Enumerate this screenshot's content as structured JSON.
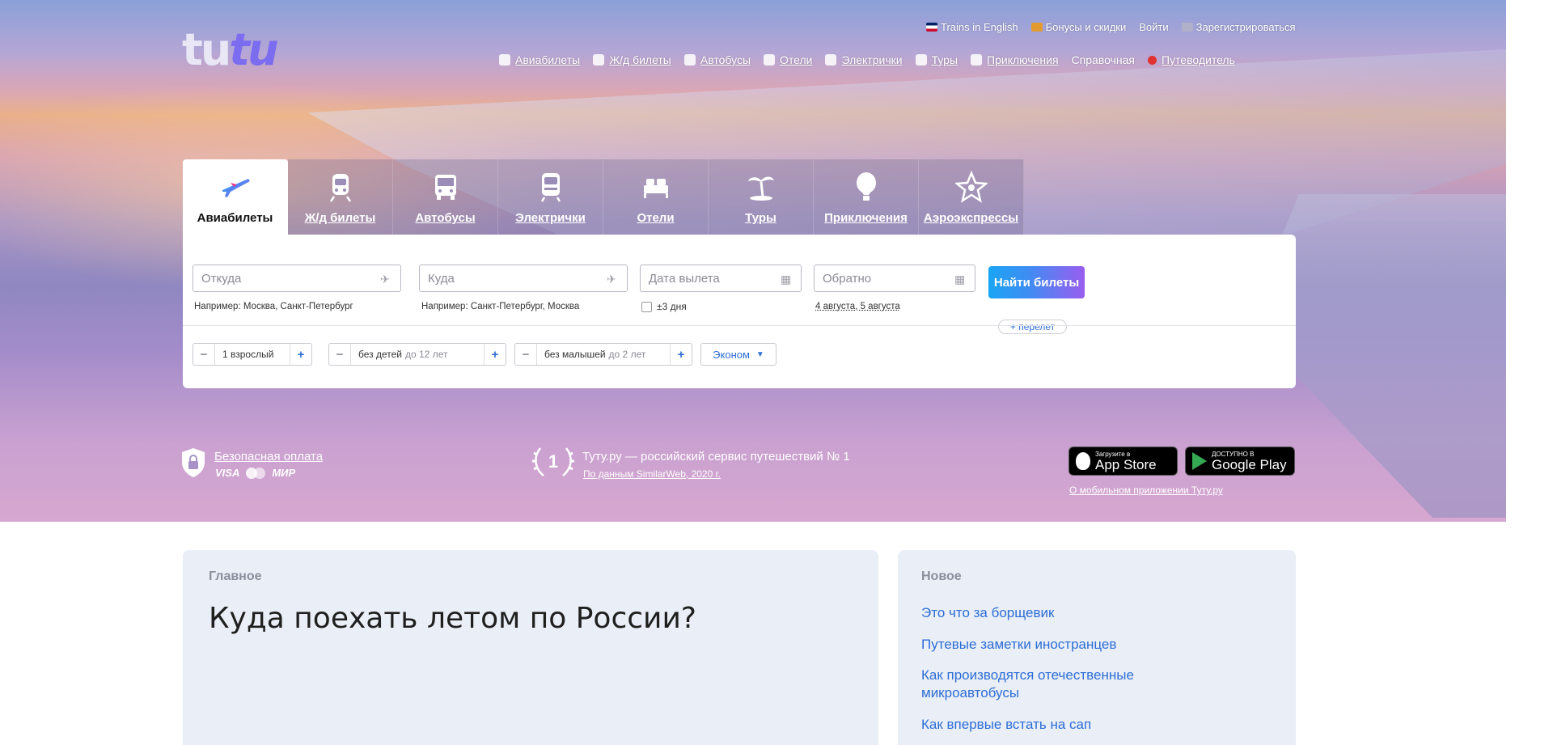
{
  "header": {
    "logo": {
      "part1": "tu",
      "part2": "tu"
    },
    "top_links": [
      {
        "label": "Trains in English",
        "icon": "uk-flag-icon"
      },
      {
        "label": "Бонусы и скидки",
        "icon": "gift-icon"
      },
      {
        "label": "Войти",
        "icon": ""
      },
      {
        "label": "Зарегистрироваться",
        "icon": "cabinet-icon"
      }
    ],
    "nav": [
      {
        "label": "Авиабилеты",
        "icon": "plane-icon"
      },
      {
        "label": "Ж/д билеты",
        "icon": "train-icon"
      },
      {
        "label": "Автобусы",
        "icon": "bus-icon"
      },
      {
        "label": "Отели",
        "icon": "hotel-icon"
      },
      {
        "label": "Электрички",
        "icon": "suburban-train-icon"
      },
      {
        "label": "Туры",
        "icon": "tour-icon"
      },
      {
        "label": "Приключения",
        "icon": "balloon-icon"
      },
      {
        "label": "Справочная",
        "icon": ""
      },
      {
        "label": "Путеводитель",
        "icon": "guide-icon"
      }
    ]
  },
  "search": {
    "tabs": [
      {
        "label": "Авиабилеты",
        "icon": "plane-icon",
        "active": true
      },
      {
        "label": "Ж/д билеты",
        "icon": "train-icon",
        "active": false
      },
      {
        "label": "Автобусы",
        "icon": "bus-icon",
        "active": false
      },
      {
        "label": "Электрички",
        "icon": "suburban-train-icon",
        "active": false
      },
      {
        "label": "Отели",
        "icon": "bed-icon",
        "active": false
      },
      {
        "label": "Туры",
        "icon": "palm-icon",
        "active": false
      },
      {
        "label": "Приключения",
        "icon": "balloon-icon",
        "active": false
      },
      {
        "label": "Аэроэкспрессы",
        "icon": "star-icon",
        "active": false
      }
    ],
    "from": {
      "placeholder": "Откуда",
      "hint": "Например: Москва, Санкт-Петербург"
    },
    "to": {
      "placeholder": "Куда",
      "hint": "Например: Санкт-Петербург, Москва"
    },
    "depart": {
      "placeholder": "Дата вылета",
      "flex_label": "±3 дня"
    },
    "return": {
      "placeholder": "Обратно",
      "hint": "4 августа, 5 августа"
    },
    "find_button": "Найти билеты",
    "add_flight": "+ перелет",
    "adults": {
      "value": "1 взрослый"
    },
    "children": {
      "value": "без детей",
      "suffix": "до 12 лет"
    },
    "infants": {
      "value": "без малышей",
      "suffix": "до 2 лет"
    },
    "class": {
      "value": "Эконом"
    }
  },
  "trust": {
    "safe_payment": "Безопасная оплата",
    "pay_systems": [
      "VISA",
      "МИР"
    ],
    "award_number": "1",
    "award_title": "Туту.ру — российский сервис путешествий № 1",
    "award_source": "По данным SimilarWeb, 2020 г.",
    "app_store": {
      "small": "Загрузите в",
      "big": "App Store"
    },
    "google_play": {
      "small": "ДОСТУПНО В",
      "big": "Google Play"
    },
    "mobile_link": "О мобильном приложении Туту.ру"
  },
  "content": {
    "main_label": "Главное",
    "main_title": "Куда поехать летом по России?",
    "new_label": "Новое",
    "news": [
      "Это что за борщевик",
      "Путевые заметки иностранцев",
      "Как производятся отечественные микроавтобусы",
      "Как впервые встать на сап"
    ]
  },
  "colors": {
    "accent": "#2d6ed6",
    "logo_purple": "#7b6cf0",
    "button_from": "#1aa5f5",
    "button_to": "#9a5df0"
  }
}
